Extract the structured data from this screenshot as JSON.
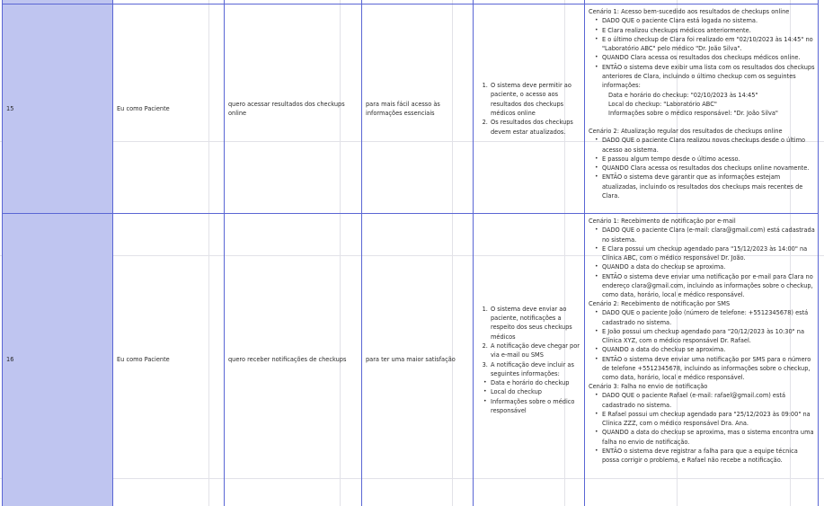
{
  "rows": [
    {
      "id": "15",
      "persona": "Eu como Paciente",
      "action": "quero acessar resultados dos checkups online",
      "benefit": "para mais fácil acesso às informações essenciais",
      "criteria": [
        "O sistema deve permitir ao paciente, o acesso aos resultados dos checkups médicos online",
        "Os resultados dos checkups devem estar atualizados."
      ],
      "scenarios": [
        {
          "title": "Cenário 1: Acesso bem-sucedido aos resultados de checkups online",
          "items": [
            "DADO QUE o paciente Clara está logada no sistema.",
            "E Clara realizou checkups médicos anteriormente.",
            "E o último checkup de Clara foi realizado em \"02/10/2023 às 14:45\" no \"Laboratório ABC\" pelo médico \"Dr. João Silva\".",
            "QUANDO Clara acessa os resultados dos checkups médicos online.",
            "ENTÃO o sistema deve exibir uma lista com os resultados dos checkups anteriores de Clara, incluindo o último checkup com os seguintes informações:"
          ],
          "details": [
            "Data e horário do checkup: \"02/10/2023 às 14:45\"",
            "Local do checkup: \"Laboratório ABC\"",
            "Informações sobre o médico responsável: \"Dr. João Silva\""
          ]
        },
        {
          "title": "Cenário 2: Atualização regular dos resultados de checkups online",
          "items": [
            "DADO QUE o paciente Clara realizou novos checkups desde o último acesso ao sistema.",
            "E passou algum tempo desde o último acesso.",
            "QUANDO Clara acessa os resultados dos checkups online novamente.",
            "ENTÃO o sistema deve garantir que as informações estejam atualizadas, incluindo os resultados dos checkups mais recentes de Clara."
          ]
        }
      ]
    },
    {
      "id": "16",
      "persona": "Eu como Paciente",
      "action": "quero receber notificações de checkups",
      "benefit": "para ter uma maior satisfação",
      "criteria": [
        "O sistema deve enviar ao paciente, notificações a respeito dos seus checkups médicos",
        "A notificação deve chegar por via e-mail ou SMS",
        "A notificação deve incluir as seguintes informações:"
      ],
      "criteria_bullets": [
        "Data e horário do checkup",
        "Local do checkup",
        "Informações sobre o médico responsável"
      ],
      "scenarios": [
        {
          "title": "Cenário 1: Recebimento de notificação por e-mail",
          "items": [
            "DADO QUE o paciente Clara (e-mail: clara@gmail.com) está cadastrada no sistema.",
            "E Clara possui um checkup agendado para \"15/12/2023 às 14:00\" na Clínica ABC, com o médico responsável Dr. João.",
            "QUANDO a data do checkup se aproxima.",
            "ENTÃO o sistema deve enviar uma notificação por e-mail para Clara no endereço clara@gmail.com, incluindo as informações sobre o checkup, como data, horário, local e médico responsável."
          ]
        },
        {
          "title": "Cenário 2: Recebimento de notificação por SMS",
          "items": [
            "DADO QUE o paciente João (número de telefone: +5512345678) está cadastrado no sistema.",
            "E João possui um checkup agendado para \"20/12/2023 às 10:30\" na Clínica XYZ, com o médico responsável Dr. Rafael.",
            "QUANDO a data do checkup se aproxima.",
            "ENTÃO o sistema deve enviar uma notificação por SMS para o número de telefone +5512345678, incluindo as informações sobre o checkup, como data, horário, local e médico responsável."
          ]
        },
        {
          "title": "Cenário 3: Falha no envio de notificação",
          "items": [
            "DADO QUE o paciente Rafael (e-mail: rafael@gmail.com) está cadastrado no sistema.",
            "E Rafael possui um checkup agendado para \"25/12/2023 às 09:00\" na Clínica ZZZ, com o médico responsável Dra. Ana.",
            "QUANDO a data do checkup se aproxima, mas o sistema encontra uma falha no envio de notificação.",
            "ENTÃO o sistema deve registrar a falha para que a equipe técnica possa corrigir o problema, e Rafael não recebe a notificação."
          ]
        }
      ]
    }
  ]
}
